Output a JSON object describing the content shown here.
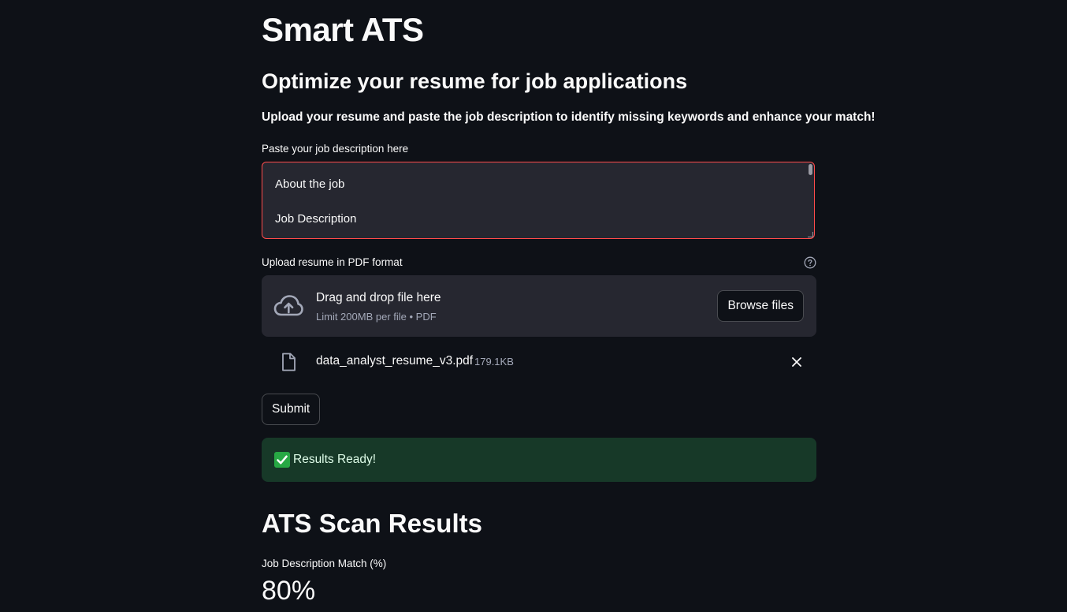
{
  "header": {
    "title": "Smart ATS",
    "subtitle": "Optimize your resume for job applications",
    "intro": "Upload your resume and paste the job description to identify missing keywords and enhance your match!"
  },
  "job_description": {
    "label": "Paste your job description here",
    "lines": [
      "About the job",
      "Job Description"
    ]
  },
  "uploader": {
    "label": "Upload resume in PDF format",
    "drop_title": "Drag and drop file here",
    "drop_subtitle": "Limit 200MB per file • PDF",
    "browse_label": "Browse files",
    "file": {
      "name": "data_analyst_resume_v3.pdf",
      "size": "179.1KB"
    }
  },
  "actions": {
    "submit_label": "Submit"
  },
  "status": {
    "message": "Results Ready!"
  },
  "results": {
    "title": "ATS Scan Results",
    "metric_label": "Job Description Match (%)",
    "metric_value": "80%"
  },
  "colors": {
    "background": "#0e1117",
    "input_bg": "#262730",
    "focus_border": "#ff4b4b",
    "success_bg": "#173928",
    "success_check": "#27a844"
  }
}
